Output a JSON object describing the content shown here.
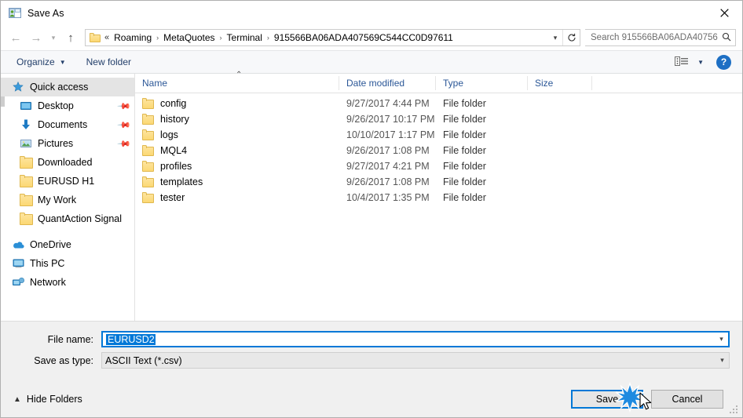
{
  "window": {
    "title": "Save As",
    "title_icon": "save-as-icon",
    "close_icon": "close-icon"
  },
  "nav": {
    "back_icon": "back-arrow-icon",
    "forward_icon": "forward-arrow-icon",
    "recent_icon": "chevron-down-icon",
    "up_icon": "up-arrow-icon",
    "folder_icon": "folder-icon",
    "breadcrumbs": [
      "Roaming",
      "MetaQuotes",
      "Terminal",
      "915566BA06ADA407569C544CC0D97611"
    ],
    "leading_sep": "«",
    "separator": "›",
    "dropdown_icon": "chevron-down-icon",
    "refresh_icon": "refresh-icon"
  },
  "search": {
    "placeholder": "Search 915566BA06ADA40756...",
    "icon": "search-icon"
  },
  "toolbar": {
    "organize_label": "Organize",
    "organize_caret": "▼",
    "new_folder_label": "New folder",
    "view_icon": "view-list-icon",
    "view_caret": "▼",
    "help_icon": "help-icon",
    "help_label": "?"
  },
  "sidebar": {
    "items": [
      {
        "label": "Quick access",
        "icon": "star-icon",
        "selected": true,
        "root": true,
        "pinned": false
      },
      {
        "label": "Desktop",
        "icon": "desktop-icon",
        "selected": false,
        "root": false,
        "pinned": true
      },
      {
        "label": "Documents",
        "icon": "documents-icon",
        "selected": false,
        "root": false,
        "pinned": true
      },
      {
        "label": "Pictures",
        "icon": "pictures-icon",
        "selected": false,
        "root": false,
        "pinned": true
      },
      {
        "label": "Downloaded",
        "icon": "folder-icon",
        "selected": false,
        "root": false,
        "pinned": false
      },
      {
        "label": "EURUSD H1",
        "icon": "folder-icon",
        "selected": false,
        "root": false,
        "pinned": false
      },
      {
        "label": "My Work",
        "icon": "folder-icon",
        "selected": false,
        "root": false,
        "pinned": false
      },
      {
        "label": "QuantAction Signal",
        "icon": "folder-icon",
        "selected": false,
        "root": false,
        "pinned": false
      }
    ],
    "roots": [
      {
        "label": "OneDrive",
        "icon": "onedrive-icon"
      },
      {
        "label": "This PC",
        "icon": "this-pc-icon"
      },
      {
        "label": "Network",
        "icon": "network-icon"
      }
    ],
    "pin_glyph": "📌"
  },
  "filelist": {
    "columns": [
      "Name",
      "Date modified",
      "Type",
      "Size"
    ],
    "sort_indicator": "⌃",
    "rows": [
      {
        "name": "config",
        "date": "9/27/2017 4:44 PM",
        "type": "File folder",
        "size": ""
      },
      {
        "name": "history",
        "date": "9/26/2017 10:17 PM",
        "type": "File folder",
        "size": ""
      },
      {
        "name": "logs",
        "date": "10/10/2017 1:17 PM",
        "type": "File folder",
        "size": ""
      },
      {
        "name": "MQL4",
        "date": "9/26/2017 1:08 PM",
        "type": "File folder",
        "size": ""
      },
      {
        "name": "profiles",
        "date": "9/27/2017 4:21 PM",
        "type": "File folder",
        "size": ""
      },
      {
        "name": "templates",
        "date": "9/26/2017 1:08 PM",
        "type": "File folder",
        "size": ""
      },
      {
        "name": "tester",
        "date": "10/4/2017 1:35 PM",
        "type": "File folder",
        "size": ""
      }
    ]
  },
  "form": {
    "filename_label": "File name:",
    "filename_value": "EURUSD2",
    "filetype_label": "Save as type:",
    "filetype_value": "ASCII Text (*.csv)",
    "dropdown_icon": "chevron-down-icon"
  },
  "footer": {
    "hide_folders_label": "Hide Folders",
    "hide_folders_icon": "chevron-up-icon",
    "save_label": "Save",
    "cancel_label": "Cancel",
    "resize_grip_icon": "resize-grip-icon"
  },
  "colors": {
    "accent": "#0078d7",
    "header_text": "#2b5797",
    "toolbar_text": "#24406b",
    "folder": "#fcd873",
    "chrome": "#f0f0f0"
  }
}
